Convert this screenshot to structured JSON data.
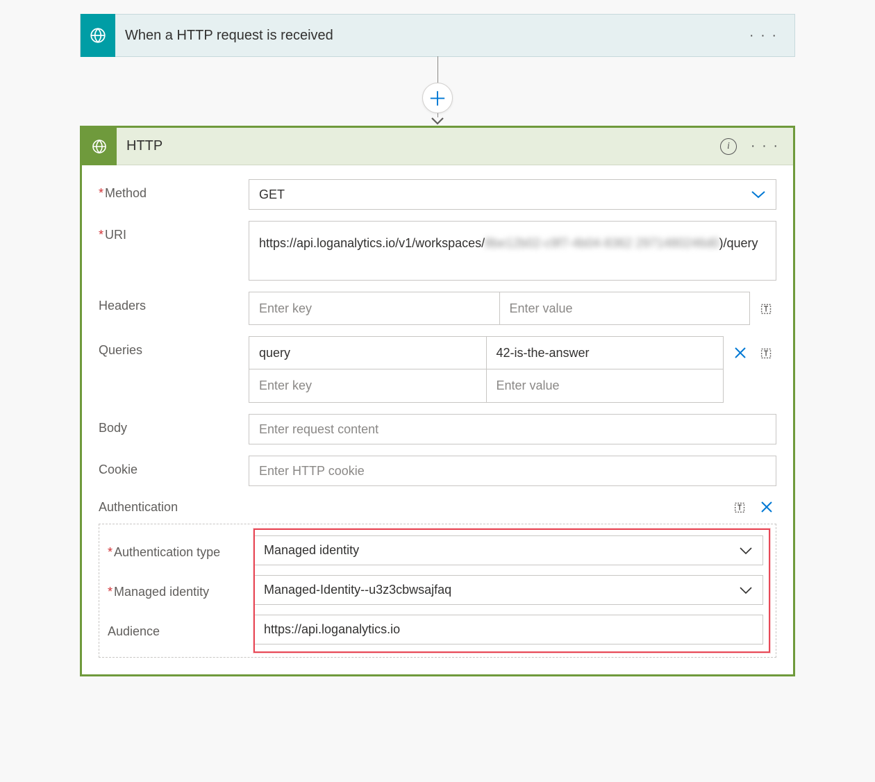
{
  "trigger": {
    "title": "When a HTTP request is received"
  },
  "action": {
    "title": "HTTP",
    "method": {
      "label": "Method",
      "value": "GET"
    },
    "uri": {
      "label": "URI",
      "prefix": "https://api.loganalytics.io/v1/workspaces/",
      "redacted1": "8be12b02-c9f7-4b04-8362",
      "redacted2": "2971480246d0",
      "suffix": ")/query"
    },
    "headers": {
      "label": "Headers",
      "key_placeholder": "Enter key",
      "value_placeholder": "Enter value"
    },
    "queries": {
      "label": "Queries",
      "rows": [
        {
          "key": "query",
          "value": "42-is-the-answer"
        }
      ],
      "key_placeholder": "Enter key",
      "value_placeholder": "Enter value"
    },
    "body": {
      "label": "Body",
      "placeholder": "Enter request content"
    },
    "cookie": {
      "label": "Cookie",
      "placeholder": "Enter HTTP cookie"
    },
    "auth": {
      "label": "Authentication",
      "type_label": "Authentication type",
      "type_value": "Managed identity",
      "identity_label": "Managed identity",
      "identity_value": "Managed-Identity--u3z3cbwsajfaq",
      "audience_label": "Audience",
      "audience_value": "https://api.loganalytics.io"
    }
  }
}
